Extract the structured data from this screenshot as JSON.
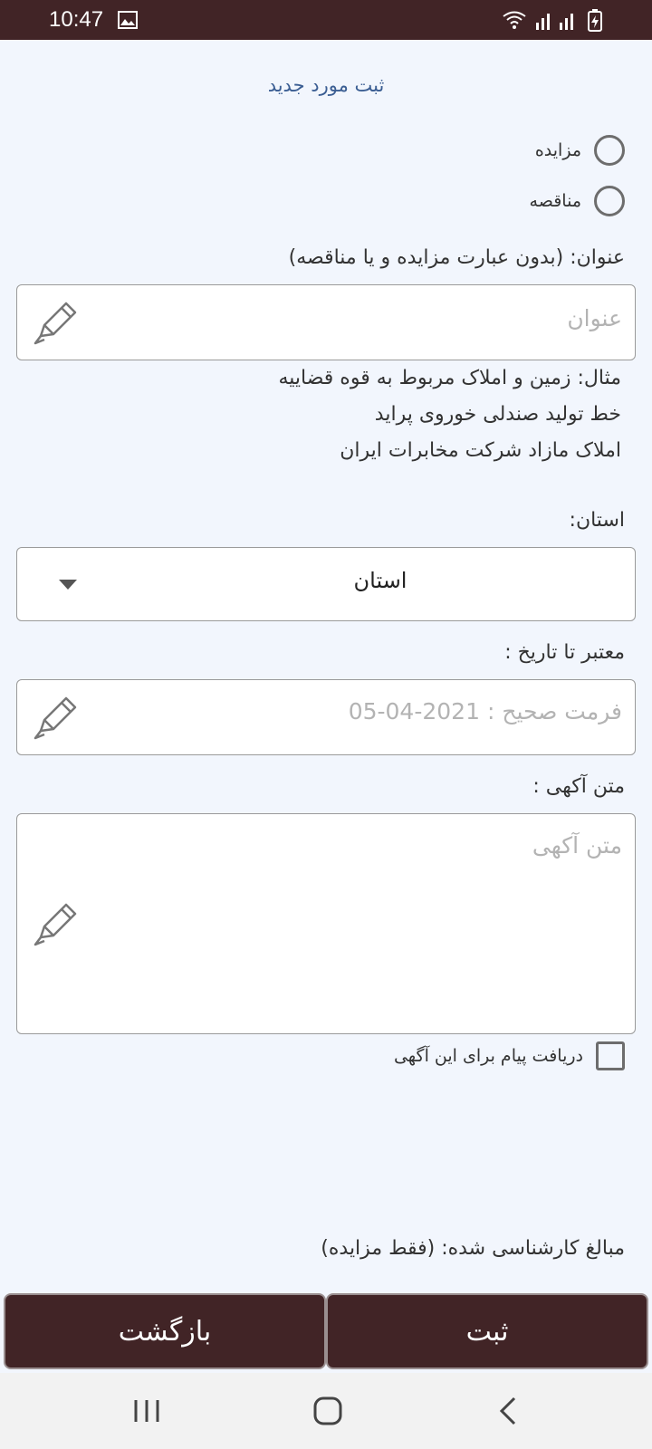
{
  "status_bar": {
    "time": "10:47",
    "icons": [
      "gallery-icon",
      "wifi-icon",
      "signal-icon",
      "signal-icon",
      "battery-charging-icon"
    ]
  },
  "page": {
    "title": "ثبت مورد جدید"
  },
  "type_options": [
    {
      "label": "مزایده",
      "selected": false
    },
    {
      "label": "مناقصه",
      "selected": false
    }
  ],
  "title_field": {
    "label": "عنوان: (بدون عبارت مزایده و یا مناقصه)",
    "placeholder": "عنوان",
    "value": "",
    "icon": "pencil-icon"
  },
  "examples": [
    "مثال: زمین و املاک مربوط به قوه قضاییه",
    "خط تولید صندلی خوروی پراید",
    "املاک مازاد شرکت مخابرات ایران"
  ],
  "province": {
    "label": "استان:",
    "selected": "استان",
    "icon": "dropdown-arrow-icon"
  },
  "valid_until": {
    "label": "معتبر تا تاریخ :",
    "placeholder": "فرمت صحیح : 2021-04-05",
    "value": "",
    "icon": "pencil-icon"
  },
  "ad_text": {
    "label": "متن آکهی :",
    "placeholder": "متن آکهی",
    "value": "",
    "icon": "pencil-icon"
  },
  "receive_messages": {
    "label": "دریافت پیام برای این آگهی",
    "checked": false
  },
  "appraisal": {
    "label": "مبالغ کارشناسی شده: (فقط مزایده)"
  },
  "buttons": {
    "submit": "ثبت",
    "back": "بازگشت"
  },
  "colors": {
    "primary": "#412426",
    "background": "#f2f6fd",
    "title": "#3b5e93"
  }
}
